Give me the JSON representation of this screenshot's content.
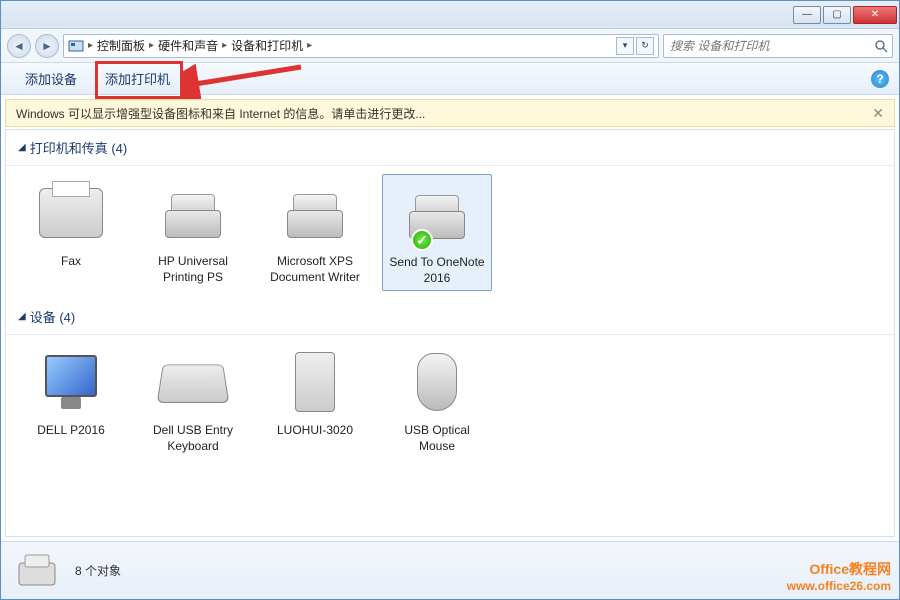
{
  "titlebar": {
    "min": "—",
    "max": "▢",
    "close": "✕"
  },
  "nav": {
    "back": "◄",
    "fwd": "►"
  },
  "breadcrumbs": {
    "icon": "control-panel",
    "items": [
      "控制面板",
      "硬件和声音",
      "设备和打印机"
    ]
  },
  "addr_dropdown": "▾",
  "refresh": "↻",
  "search": {
    "placeholder": "搜索 设备和打印机"
  },
  "toolbar": {
    "add_device": "添加设备",
    "add_printer": "添加打印机",
    "help": "?"
  },
  "infobar": {
    "text": "Windows 可以显示增强型设备图标和来自 Internet 的信息。请单击进行更改...",
    "close": "✕"
  },
  "groups": [
    {
      "title": "打印机和传真 (4)",
      "items": [
        {
          "label": "Fax",
          "icon": "fax",
          "default": false
        },
        {
          "label": "HP Universal Printing PS",
          "icon": "printer",
          "default": false
        },
        {
          "label": "Microsoft XPS Document Writer",
          "icon": "printer",
          "default": false
        },
        {
          "label": "Send To OneNote 2016",
          "icon": "printer",
          "default": true,
          "selected": true
        }
      ]
    },
    {
      "title": "设备 (4)",
      "items": [
        {
          "label": "DELL P2016",
          "icon": "monitor"
        },
        {
          "label": "Dell USB Entry Keyboard",
          "icon": "keyboard"
        },
        {
          "label": "LUOHUI-3020",
          "icon": "tower"
        },
        {
          "label": "USB Optical Mouse",
          "icon": "mouse"
        }
      ]
    }
  ],
  "status": {
    "count": "8 个对象"
  },
  "watermark": {
    "line1": "Office教程网",
    "line2": "www.office26.com"
  }
}
